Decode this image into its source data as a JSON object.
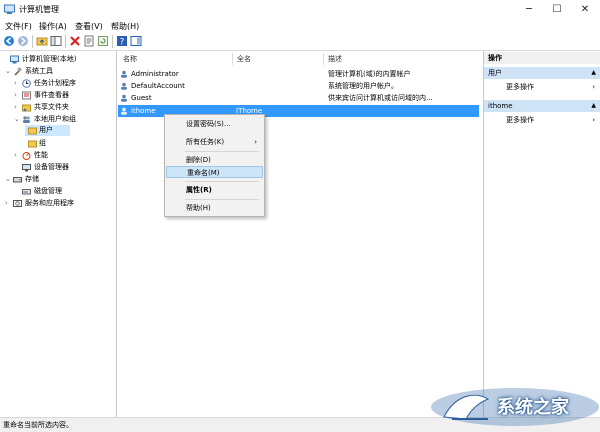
{
  "window": {
    "title": "计算机管理",
    "minimize": "─",
    "maximize": "☐",
    "close": "✕"
  },
  "menu": [
    "文件(F)",
    "操作(A)",
    "查看(V)",
    "帮助(H)"
  ],
  "toolbar_icons": [
    "back-icon",
    "forward-icon",
    "up-folder-icon",
    "show-hide-tree-icon",
    "delete-icon",
    "properties-icon",
    "refresh-icon",
    "export-icon",
    "help-icon",
    "view-icon"
  ],
  "tree": [
    {
      "label": "计算机管理(本地)",
      "arrow": "",
      "icon": "computer-management-icon"
    },
    {
      "label": "系统工具",
      "arrow": "⌄",
      "icon": "tools-icon"
    },
    {
      "label": "任务计划程序",
      "arrow": "›",
      "icon": "clock-icon"
    },
    {
      "label": "事件查看器",
      "arrow": "›",
      "icon": "event-viewer-icon"
    },
    {
      "label": "共享文件夹",
      "arrow": "›",
      "icon": "shared-folder-icon"
    },
    {
      "label": "本地用户和组",
      "arrow": "⌄",
      "icon": "users-icon"
    },
    {
      "label": "用户",
      "arrow": "",
      "icon": "folder-icon"
    },
    {
      "label": "组",
      "arrow": "",
      "icon": "folder-icon"
    },
    {
      "label": "性能",
      "arrow": "›",
      "icon": "performance-icon"
    },
    {
      "label": "设备管理器",
      "arrow": "",
      "icon": "device-manager-icon"
    },
    {
      "label": "存储",
      "arrow": "⌄",
      "icon": "storage-icon"
    },
    {
      "label": "磁盘管理",
      "arrow": "",
      "icon": "disk-icon"
    },
    {
      "label": "服务和应用程序",
      "arrow": "›",
      "icon": "services-icon"
    }
  ],
  "columns": {
    "name": "名称",
    "fullname": "全名",
    "desc": "描述"
  },
  "users": [
    {
      "name": "Administrator",
      "fullname": "",
      "desc": "管理计算机(域)的内置帐户"
    },
    {
      "name": "DefaultAccount",
      "fullname": "",
      "desc": "系统管理的用户帐户。"
    },
    {
      "name": "Guest",
      "fullname": "",
      "desc": "供来宾访问计算机或访问域的内..."
    },
    {
      "name": "ithome",
      "fullname": "IThome",
      "desc": ""
    }
  ],
  "context_menu": {
    "set_password": "设置密码(S)...",
    "all_tasks": "所有任务(K)",
    "delete": "删除(D)",
    "rename": "重命名(M)",
    "properties": "属性(R)",
    "help": "帮助(H)",
    "submenu_chevron": "›"
  },
  "actions": {
    "header": "操作",
    "section1": "用户",
    "section2": "ithome",
    "more": "更多操作",
    "caret_up": "▲",
    "chevron": "›"
  },
  "status": "重命名当前所选内容。",
  "watermark": "系统之家",
  "colors": {
    "selection": "#3399ff",
    "tree_selection": "#cce8ff",
    "action_section": "#cfe3f7"
  }
}
